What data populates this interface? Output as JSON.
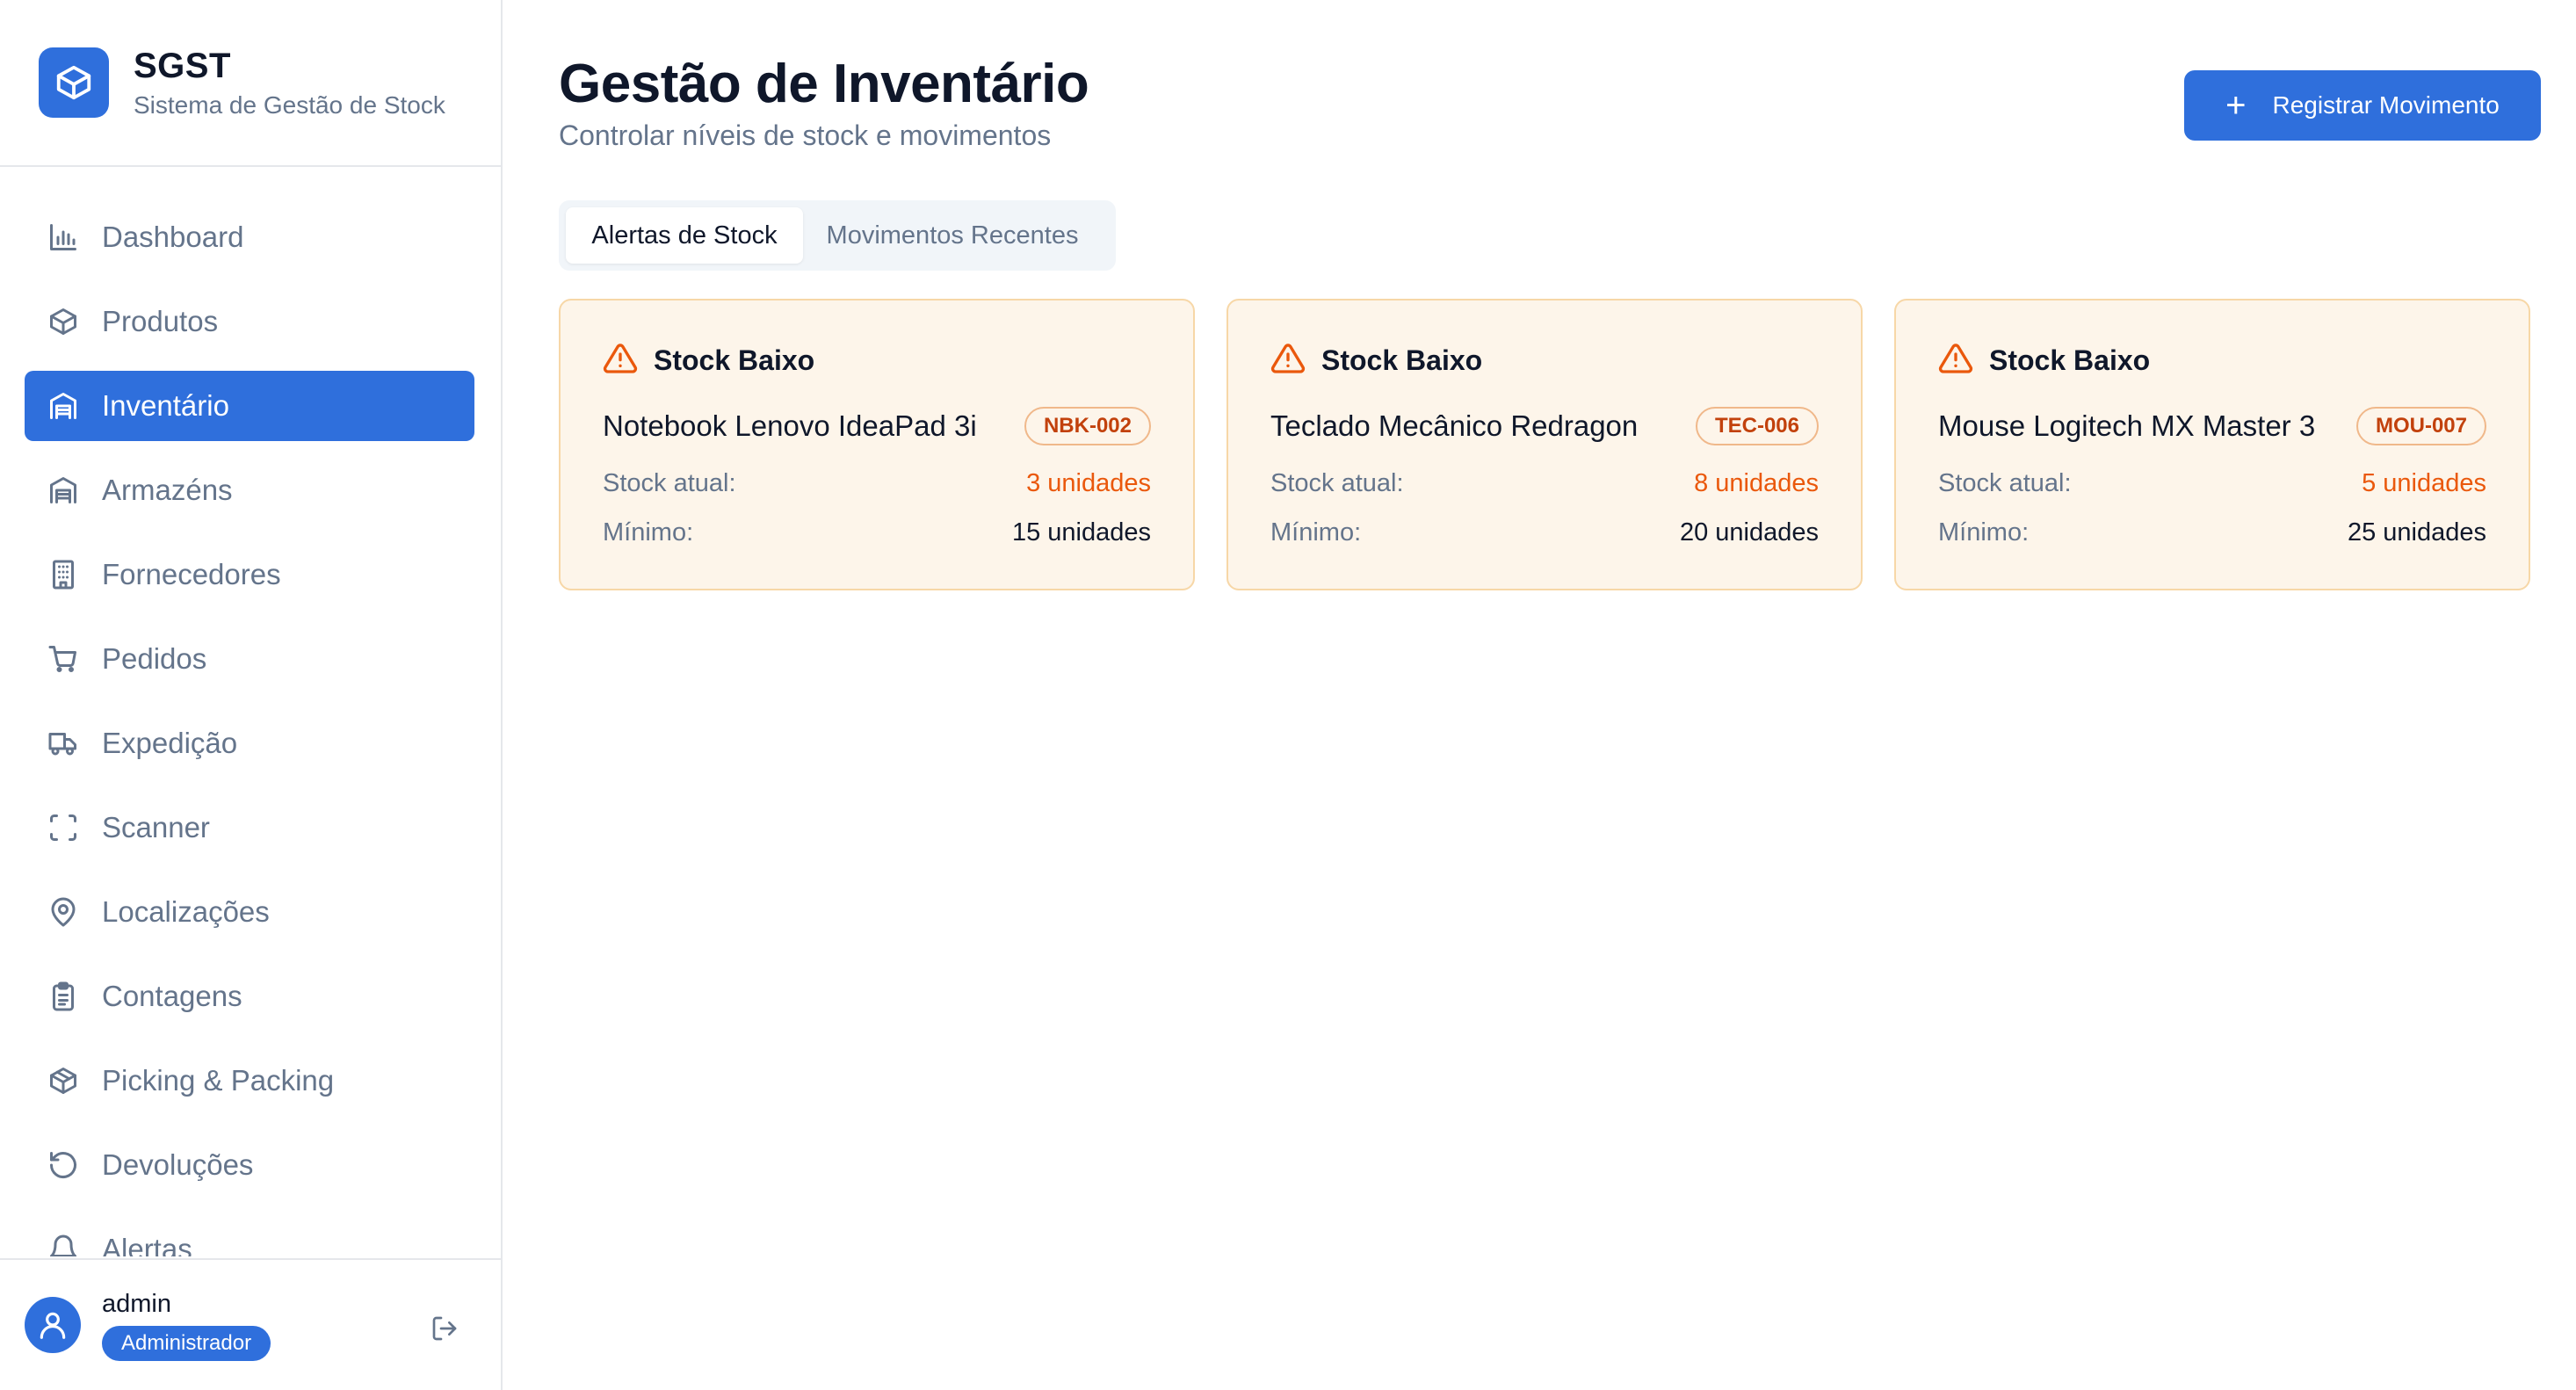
{
  "brand": {
    "name": "SGST",
    "subtitle": "Sistema de Gestão de Stock"
  },
  "sidebar": {
    "items": [
      {
        "label": "Dashboard",
        "icon": "bar-chart-icon"
      },
      {
        "label": "Produtos",
        "icon": "package-icon"
      },
      {
        "label": "Inventário",
        "icon": "warehouse-icon",
        "active": true
      },
      {
        "label": "Armazéns",
        "icon": "warehouse-icon"
      },
      {
        "label": "Fornecedores",
        "icon": "building-icon"
      },
      {
        "label": "Pedidos",
        "icon": "shopping-cart-icon"
      },
      {
        "label": "Expedição",
        "icon": "truck-icon"
      },
      {
        "label": "Scanner",
        "icon": "scan-icon"
      },
      {
        "label": "Localizações",
        "icon": "map-pin-icon"
      },
      {
        "label": "Contagens",
        "icon": "clipboard-icon"
      },
      {
        "label": "Picking & Packing",
        "icon": "package-open-icon"
      },
      {
        "label": "Devoluções",
        "icon": "rotate-ccw-icon"
      },
      {
        "label": "Alertas",
        "icon": "bell-icon"
      }
    ]
  },
  "user": {
    "name": "admin",
    "role": "Administrador"
  },
  "header": {
    "title": "Gestão de Inventário",
    "subtitle": "Controlar níveis de stock e movimentos",
    "action_label": "Registrar Movimento"
  },
  "tabs": [
    {
      "label": "Alertas de Stock",
      "active": true
    },
    {
      "label": "Movimentos Recentes",
      "active": false
    }
  ],
  "alerts": [
    {
      "type": "Stock Baixo",
      "product": "Notebook Lenovo IdeaPad 3i",
      "sku": "NBK-002",
      "current_label": "Stock atual:",
      "current_value": "3 unidades",
      "min_label": "Mínimo:",
      "min_value": "15 unidades"
    },
    {
      "type": "Stock Baixo",
      "product": "Teclado Mecânico Redragon",
      "sku": "TEC-006",
      "current_label": "Stock atual:",
      "current_value": "8 unidades",
      "min_label": "Mínimo:",
      "min_value": "20 unidades"
    },
    {
      "type": "Stock Baixo",
      "product": "Mouse Logitech MX Master 3",
      "sku": "MOU-007",
      "current_label": "Stock atual:",
      "current_value": "5 unidades",
      "min_label": "Mínimo:",
      "min_value": "25 unidades"
    }
  ],
  "colors": {
    "primary": "#2f6fdc",
    "warning": "#ea580c",
    "alert_bg": "#fdf5ea",
    "alert_border": "#f7d7a7"
  }
}
